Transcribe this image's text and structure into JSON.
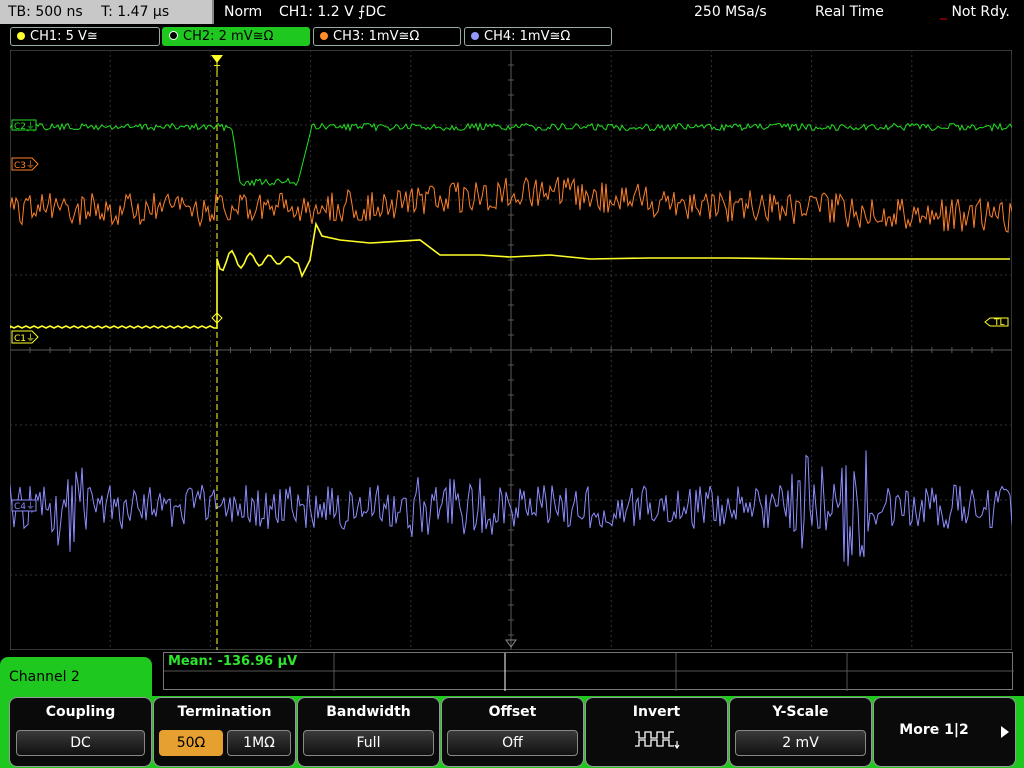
{
  "status": {
    "timebase": "TB: 500 ns",
    "trigger_time": "T: 1.47 µs",
    "mode": "Norm",
    "trigger": "CH1: 1.2 V ⨍DC",
    "sample_rate": "250 MSa/s",
    "acq_mode": "Real Time",
    "run_state": "Not Rdy."
  },
  "channels": [
    {
      "label": "CH1: 5 V≅",
      "color": "#ffff30"
    },
    {
      "label": "CH2: 2 mV≅Ω",
      "color": "#1ec81e"
    },
    {
      "label": "CH3: 1mV≅Ω",
      "color": "#ff8c28"
    },
    {
      "label": "CH4: 1mV≅Ω",
      "color": "#9696ff"
    }
  ],
  "markers": {
    "c1": "C1⏚",
    "c2": "C2⏚",
    "c3": "C3⏚",
    "c4": "C4⏚",
    "trigger_level": "TL",
    "trigger_pos": "T"
  },
  "measurement": {
    "mean": "Mean: -136.96 µV"
  },
  "panel": {
    "title": "Channel 2",
    "coupling": {
      "title": "Coupling",
      "value": "DC"
    },
    "termination": {
      "title": "Termination",
      "opt1": "50Ω",
      "opt2": "1MΩ"
    },
    "bandwidth": {
      "title": "Bandwidth",
      "value": "Full"
    },
    "offset": {
      "title": "Offset",
      "value": "Off"
    },
    "invert": {
      "title": "Invert"
    },
    "yscale": {
      "title": "Y-Scale",
      "value": "2 mV"
    },
    "more": {
      "title": "More 1|2"
    }
  }
}
